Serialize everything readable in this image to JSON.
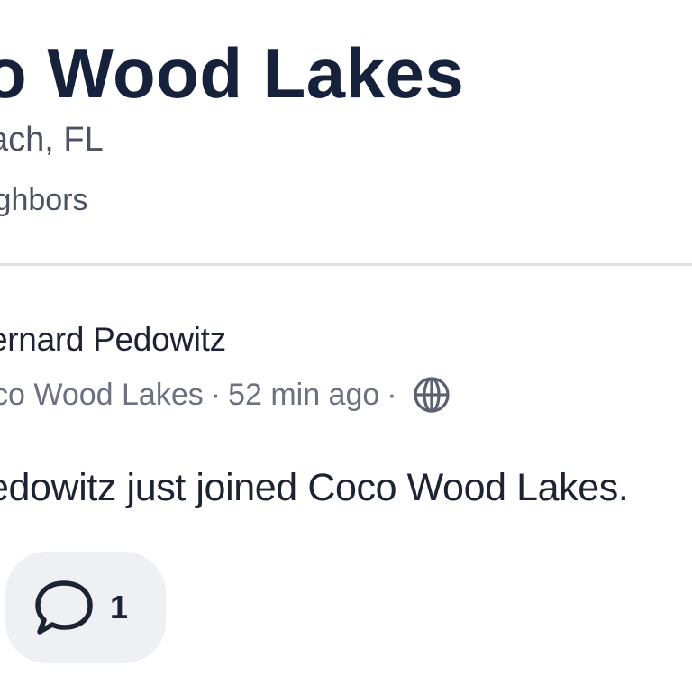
{
  "group": {
    "title": "o Wood Lakes",
    "location": "ach, FL",
    "members_label": "ighbors"
  },
  "post": {
    "author": "ernard Pedowitz",
    "group_name": "co Wood Lakes",
    "separator": "·",
    "time_ago": "52 min ago",
    "visibility_icon": "globe-icon",
    "text": "edowitz just joined Coco Wood Lakes.",
    "comment_icon": "comment-bubble-icon",
    "comment_count": "1"
  },
  "colors": {
    "title": "#16213b",
    "text_primary": "#1d2333",
    "text_secondary": "#6b7180",
    "divider": "#dcdfe6",
    "button_bg": "#eef0f4"
  }
}
